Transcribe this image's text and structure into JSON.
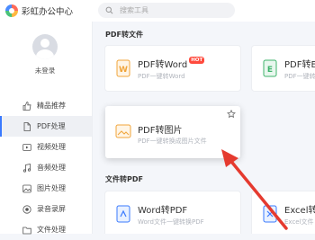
{
  "app": {
    "title": "彩虹办公中心"
  },
  "search": {
    "placeholder": "搜索工具"
  },
  "user": {
    "login_label": "未登录"
  },
  "nav": {
    "items": [
      {
        "label": "精品推荐",
        "icon": "thumbs-up-icon"
      },
      {
        "label": "PDF处理",
        "icon": "pdf-icon"
      },
      {
        "label": "视频处理",
        "icon": "video-icon"
      },
      {
        "label": "音频处理",
        "icon": "music-icon"
      },
      {
        "label": "图片处理",
        "icon": "image-icon"
      },
      {
        "label": "录音录屏",
        "icon": "record-icon"
      },
      {
        "label": "文件处理",
        "icon": "file-icon"
      }
    ],
    "active_index": 1
  },
  "sections": [
    {
      "title": "PDF转文件",
      "cards": [
        {
          "name": "PDF转Word",
          "desc": "PDF一键转Word",
          "badge": "HOT",
          "icon": "word-doc-icon"
        },
        {
          "name": "PDF转Exc",
          "desc": "PDF一键转",
          "icon": "excel-doc-icon"
        },
        {
          "name": "PDF转图片",
          "desc": "PDF一键转换成图片文件",
          "icon": "image-doc-icon"
        }
      ]
    },
    {
      "title": "文件转PDF",
      "cards": [
        {
          "name": "Word转PDF",
          "desc": "Word文件一键转换PDF",
          "icon": "word-to-pdf-icon"
        },
        {
          "name": "Excel转P",
          "desc": "Excel文件",
          "icon": "excel-to-pdf-icon"
        }
      ]
    }
  ],
  "colors": {
    "accent": "#3a7afe",
    "hot": "#ff4a3d",
    "arrow": "#e53a2f"
  }
}
